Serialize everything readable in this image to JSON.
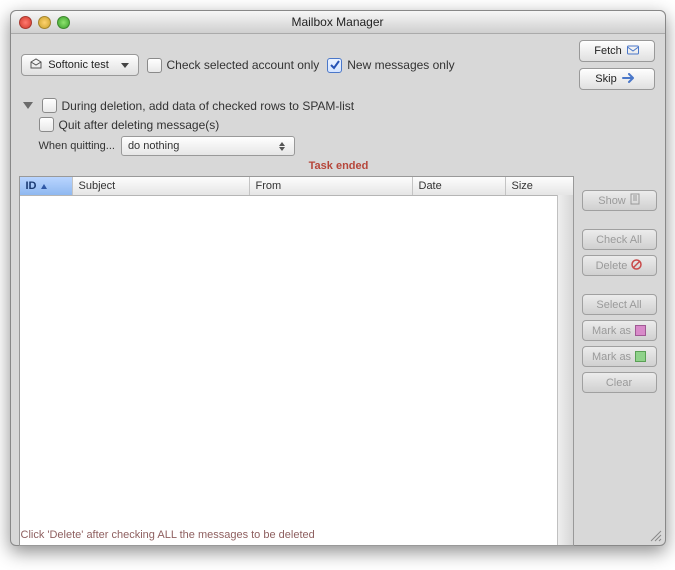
{
  "window": {
    "title": "Mailbox Manager"
  },
  "toolbar": {
    "account_select": "Softonic test",
    "check_selected_only": {
      "label": "Check selected account only",
      "checked": false
    },
    "new_messages_only": {
      "label": "New messages only",
      "checked": true
    },
    "fetch": "Fetch",
    "skip": "Skip"
  },
  "options": {
    "spam_checkbox": {
      "label": "During deletion, add data of checked rows to SPAM-list",
      "checked": false
    },
    "quit_checkbox": {
      "label": "Quit after deleting message(s)",
      "checked": false
    },
    "when_quitting_label": "When quitting...",
    "when_quitting_value": "do nothing"
  },
  "status_text": "Task ended",
  "columns": {
    "id": "ID",
    "subject": "Subject",
    "from": "From",
    "date": "Date",
    "size": "Size"
  },
  "side": {
    "show": "Show",
    "check_all": "Check All",
    "delete": "Delete",
    "select_all": "Select All",
    "mark_as_1": "Mark as",
    "mark_as_2": "Mark as",
    "clear": "Clear"
  },
  "footer": "Click 'Delete' after checking ALL the messages to be deleted",
  "colors": {
    "accent_blue": "#2f58a6",
    "status_red": "#b6463a"
  }
}
